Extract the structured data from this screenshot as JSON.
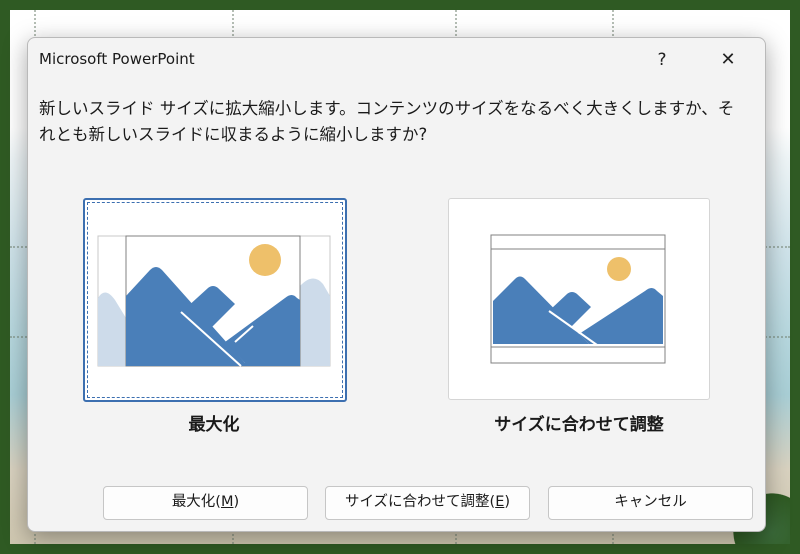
{
  "dialog": {
    "title": "Microsoft PowerPoint",
    "help_label": "?",
    "close_label": "✕",
    "message_line1": "新しいスライド サイズに拡大縮小します。コンテンツのサイズをなるべく大きくしますか、そ",
    "message_line2": "れとも新しいスライドに収まるように縮小しますか?"
  },
  "options": {
    "maximize_label": "最大化",
    "fit_label": "サイズに合わせて調整"
  },
  "buttons": {
    "maximize_text": "最大化(",
    "maximize_key": "M",
    "fit_text": "サイズに合わせて調整(",
    "fit_key": "E",
    "close_paren": ")",
    "cancel": "キャンセル"
  },
  "colors": {
    "mountain": "#4a7fb9",
    "mountain_faded": "#cddbea",
    "sun": "#eec06a",
    "selection_border": "#3c6fb0"
  }
}
